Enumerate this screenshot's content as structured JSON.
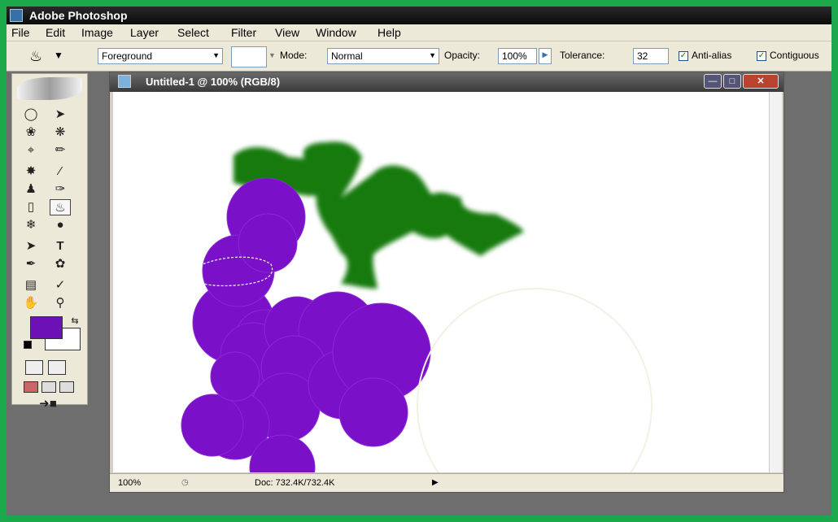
{
  "app": {
    "title": "Adobe Photoshop"
  },
  "menu": [
    "File",
    "Edit",
    "Image",
    "Layer",
    "Select",
    "Filter",
    "View",
    "Window",
    "Help"
  ],
  "options": {
    "fill_value": "Foreground",
    "mode_label": "Mode:",
    "mode_value": "Normal",
    "opacity_label": "Opacity:",
    "opacity_value": "100%",
    "tolerance_label": "Tolerance:",
    "tolerance_value": "32",
    "antialias_label": "Anti-alias",
    "contiguous_label": "Contiguous"
  },
  "document": {
    "title": "Untitled-1 @ 100% (RGB/8)",
    "zoom": "100%",
    "doc_info": "Doc: 732.4K/732.4K"
  },
  "colors": {
    "foreground": "#6b11b6",
    "background": "#ffffff",
    "grape": "#7a10c8",
    "leaf": "#137a0a"
  }
}
